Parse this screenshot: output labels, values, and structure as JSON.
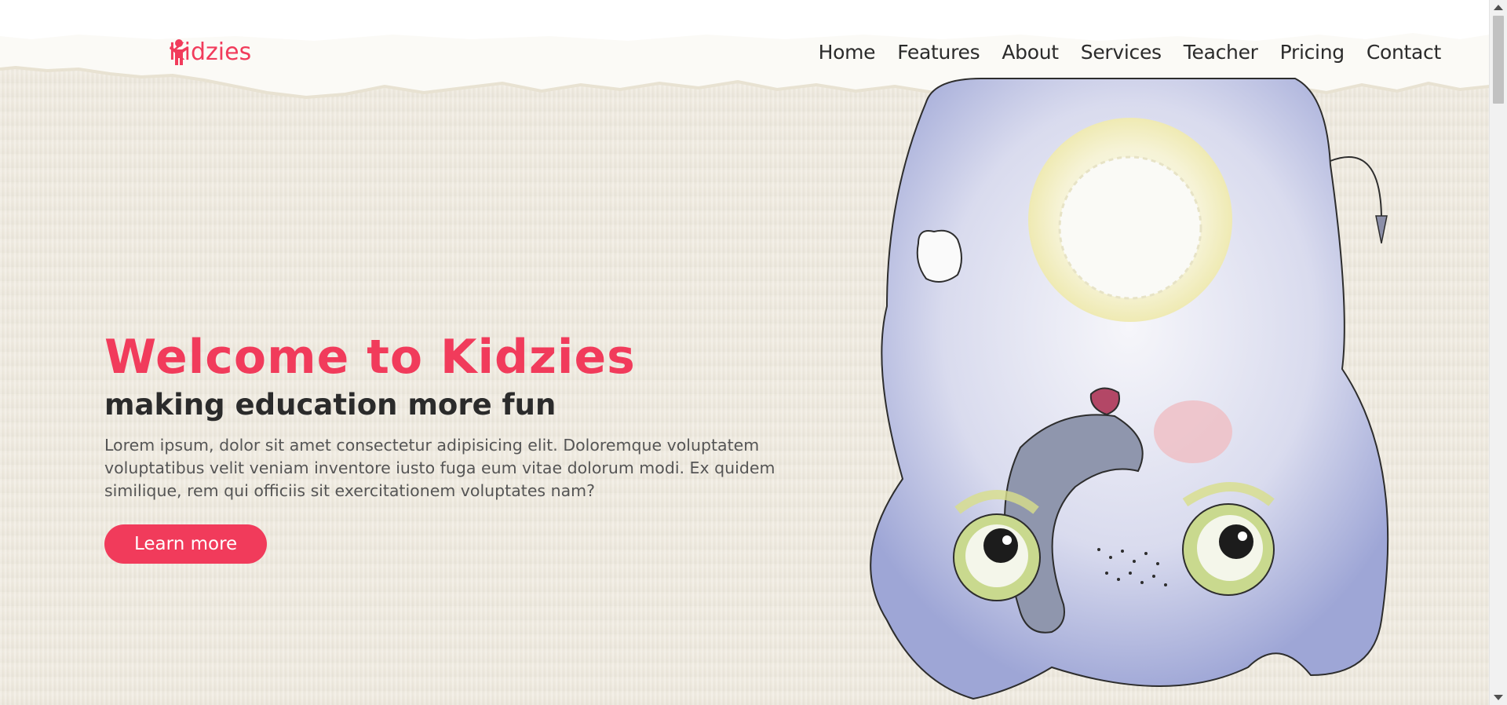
{
  "brand": {
    "name": "Kidzies",
    "icon": "child-icon",
    "color": "#f13b5b"
  },
  "nav": {
    "items": [
      {
        "label": "Home"
      },
      {
        "label": "Features"
      },
      {
        "label": "About"
      },
      {
        "label": "Services"
      },
      {
        "label": "Teacher"
      },
      {
        "label": "Pricing"
      },
      {
        "label": "Contact"
      }
    ]
  },
  "hero": {
    "title": "Welcome to Kidzies",
    "subtitle": "making education more fun",
    "description": "Lorem ipsum, dolor sit amet consectetur adipisicing elit. Doloremque voluptatem voluptatibus velit veniam inventore iusto fuga eum vitae dolorum modi. Ex quidem similique, rem qui officiis sit exercitationem voluptates nam?",
    "cta_label": "Learn more",
    "illustration": "watercolor-elephant-illustration"
  },
  "colors": {
    "accent": "#f13b5b",
    "background": "#efeadf",
    "text": "#2b2b2b"
  }
}
